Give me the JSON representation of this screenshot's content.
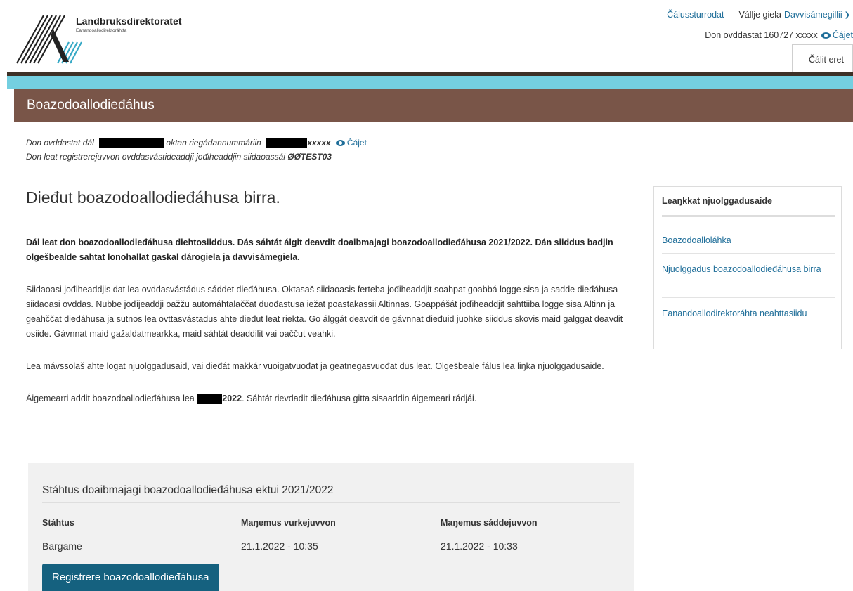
{
  "header": {
    "logo_title": "Landbruksdirektoratet",
    "logo_subtitle": "Eanandoallodirektoráhtta",
    "accessibility_link": "Čálussturrodat",
    "language_label": "Vállje giela",
    "language_value": "Davvisámegillii",
    "user_prefix": "Don ovddastat 160727 xxxxx",
    "show_label": "Čájet",
    "logout_label": "Čálit eret"
  },
  "banner": {
    "title": "Boazodoallodieđáhus"
  },
  "owner_info": {
    "line1_a": "Don ovddastat dál",
    "line1_b": "oktan riegádannummáriin",
    "line1_masked": "xxxxx",
    "line1_show": "Čájet",
    "line2_a": "Don leat registrerejuvvon ovddasvástideaddji jođiheaddjin siidaoassái",
    "line2_code": "ØØTEST03"
  },
  "main": {
    "heading": "Dieđut boazodoallodieđáhusa birra.",
    "intro": "Dál leat don boazodoallodieđáhusa diehtosiiddus. Dás sáhtát álgit deavdit doaibmajagi boazodoallodieđáhusa 2021/2022. Dán siiddus badjin olgešbealde sahtat lonohallat gaskal dárogiela ja davvisámegiela.",
    "para1": "Siidaoasi jođiheaddjis dat lea ovddasvástádus sáddet dieđáhusa. Oktasaš siidaoasis ferteba jođiheaddjit soahpat goabbá logge sisa ja sadde dieđáhusa siidaoasi ovddas. Nubbe joďijeaddji oažžu automáhtalaččat duođastusa iežat poastakassii Altinnas. Goappášát joďiheaddjit sahttiiba logge sisa Altinn ja geahččat diedáhusa ja sutnos lea ovttasvástadus ahte dieđut leat riekta. Go álggát deavdit de gávnnat dieđuid juohke siiddus skovis maid galggat deavdit osiide. Gávnnat maid gažaldatmearkka, maid sáhtát deaddilit vai oaččut veahki.",
    "para2": "Lea mávssolaš ahte logat njuolggadusaid, vai dieđát makkár vuoigatvuođat ja geatnegasvuođat dus leat. Olgešbeale fálus lea liŋka njuolggadusaide.",
    "deadline_a": "Áigemearri addit boazodoallodieđáhusa lea",
    "deadline_year": "2022",
    "deadline_b": ". Sáhtát rievdadit dieđáhusa gitta sisaaddin áigemeari rádjái."
  },
  "status": {
    "title": "Stáhtus doaibmajagi boazodoallodieđáhusa ektui 2021/2022",
    "col_status": "Stáhtus",
    "col_saved": "Maŋemus vurkejuvvon",
    "col_sent": "Maŋemus sáddejuvvon",
    "status_value": "Bargame",
    "saved_value": "21.1.2022 - 10:35",
    "sent_value": "21.1.2022 - 10:33",
    "register_button": "Registrere boazodoallodieđáhusa"
  },
  "sidebar": {
    "title": "Leaŋkkat njuolggadusaide",
    "links": [
      "Boazodoalloláhka",
      "Njuolggadus boazodoallodieđáhusa birra",
      "Eanandoallodirektoráhta neahttasiidu"
    ]
  },
  "colors": {
    "banner_brown": "#795548",
    "accent_cyan": "#74cfe0",
    "link_blue": "#1f6e99",
    "button_blue": "#15617f"
  }
}
